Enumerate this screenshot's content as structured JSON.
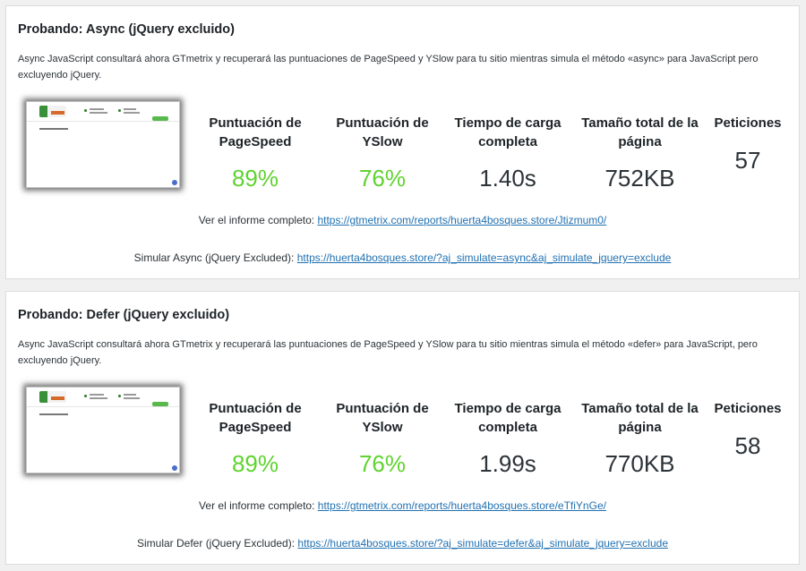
{
  "tests": [
    {
      "title": "Probando: Async (jQuery excluido)",
      "description": "Async JavaScript consultará ahora GTmetrix y recuperará las puntuaciones de PageSpeed y YSlow para tu sitio mientras simula el método «async» para JavaScript pero excluyendo jQuery.",
      "metrics": {
        "pagespeed_label": "Puntuación de PageSpeed",
        "pagespeed_value": "89%",
        "yslow_label": "Puntuación de YSlow",
        "yslow_value": "76%",
        "load_label": "Tiempo de carga completa",
        "load_value": "1.40s",
        "size_label": "Tamaño total de la página",
        "size_value": "752KB",
        "requests_label": "Peticiones",
        "requests_value": "57"
      },
      "report_prefix": "Ver el informe completo:",
      "report_link": "https://gtmetrix.com/reports/huerta4bosques.store/Jtizmum0/",
      "simulate_prefix": "Simular Async (jQuery Excluded):",
      "simulate_link": "https://huerta4bosques.store/?aj_simulate=async&aj_simulate_jquery=exclude"
    },
    {
      "title": "Probando: Defer (jQuery excluido)",
      "description": "Async JavaScript consultará ahora GTmetrix y recuperará las puntuaciones de PageSpeed y YSlow para tu sitio mientras simula el método «defer» para JavaScript, pero excluyendo jQuery.",
      "metrics": {
        "pagespeed_label": "Puntuación de PageSpeed",
        "pagespeed_value": "89%",
        "yslow_label": "Puntuación de YSlow",
        "yslow_value": "76%",
        "load_label": "Tiempo de carga completa",
        "load_value": "1.99s",
        "size_label": "Tamaño total de la página",
        "size_value": "770KB",
        "requests_label": "Peticiones",
        "requests_value": "58"
      },
      "report_prefix": "Ver el informe completo:",
      "report_link": "https://gtmetrix.com/reports/huerta4bosques.store/eTfiYnGe/",
      "simulate_prefix": "Simular Defer (jQuery Excluded):",
      "simulate_link": "https://huerta4bosques.store/?aj_simulate=defer&aj_simulate_jquery=exclude"
    }
  ],
  "colors": {
    "good_score": "#5fd32e",
    "link": "#2271b1",
    "text": "#1d2327"
  }
}
